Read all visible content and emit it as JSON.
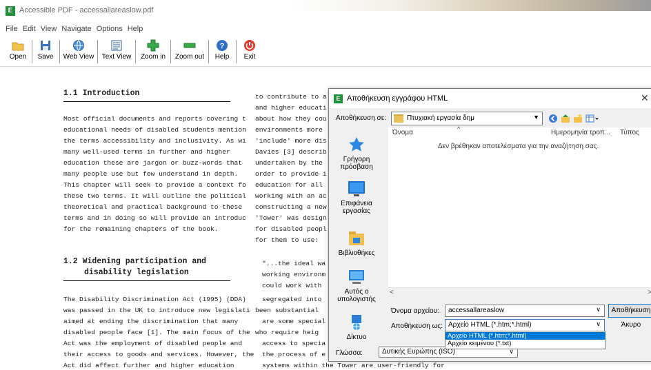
{
  "window": {
    "title": "Accessible PDF - accessallareaslow.pdf"
  },
  "menu": [
    "File",
    "Edit",
    "View",
    "Navigate",
    "Options",
    "Help"
  ],
  "toolbar": [
    {
      "label": "Open",
      "icon": "folder-icon"
    },
    {
      "label": "Save",
      "icon": "floppy-icon"
    },
    {
      "label": "Web View",
      "icon": "globe-icon"
    },
    {
      "label": "Text View",
      "icon": "text-view-icon"
    },
    {
      "label": "Zoom in",
      "icon": "zoom-in-icon"
    },
    {
      "label": "Zoom out",
      "icon": "zoom-out-icon"
    },
    {
      "label": "Help",
      "icon": "help-icon"
    },
    {
      "label": "Exit",
      "icon": "power-icon"
    }
  ],
  "document": {
    "left_lines": [
      "1.1 Introduction",
      "",
      "Most official documents and reports covering t",
      "educational needs of disabled students mention",
      "the terms accessibility and inclusivity. As wi",
      "many well-used terms in further and higher",
      "education these are jargon or buzz-words that",
      "many people use but few understand in depth.",
      "This chapter will seek to provide a context fo",
      "these two terms. It will outline the political",
      "theoretical and practical background to these",
      "terms and in doing so will provide an introduc",
      "for the remaining chapters of the book.",
      "1.2 Widening participation and",
      "disability legislation",
      "The Disability Discrimination Act (1995) (DDA)",
      "was passed in the UK to introduce new legislati",
      "aimed at ending the discrimination that many",
      "disabled people face [1]. The main focus of the",
      "Act was the employment of disabled people and",
      "their access to goods and services. However, the",
      "Act did affect further and higher education"
    ],
    "right_lines": [
      "to contribute to a",
      "and higher educati",
      "about how they cou",
      "environments more",
      "'include' more dis",
      "Davies [3] describ",
      "undertaken by the",
      "order to provide i",
      "education for all",
      "working with an ac",
      "constructing a new",
      "'Tower' was design",
      "for disabled peopl",
      "for them to use:",
      "\"...the ideal wa",
      "working environm",
      "could work with",
      "segregated into",
      "been substantial",
      "are some special",
      "who require heig",
      "access to specia",
      "the process of e",
      "systems within the Tower are user-friendly for"
    ]
  },
  "dialog": {
    "title": "Αποθήκευση εγγράφου HTML",
    "close": "✕",
    "save_in_label": "Αποθήκευση σε:",
    "save_in_value": "Πτυχιακή εργασία δημ",
    "places": [
      {
        "label": "Γρήγορη πρόσβαση",
        "icon": "star-icon"
      },
      {
        "label": "Επιφάνεια εργασίας",
        "icon": "desktop-icon"
      },
      {
        "label": "Βιβλιοθήκες",
        "icon": "library-icon"
      },
      {
        "label": "Αυτός ο υπολογιστής",
        "icon": "computer-icon"
      },
      {
        "label": "Δίκτυο",
        "icon": "network-icon"
      }
    ],
    "columns": {
      "name": "Όνομα",
      "date": "Ημερομηνία τροπ...",
      "type": "Τύπος"
    },
    "empty_message": "Δεν βρέθηκαν αποτελέσματα για την αναζήτηση σας.",
    "filename_label": "Όνομα αρχείου:",
    "filename_value": "accessallareaslow",
    "save_as_label": "Αποθήκευση ως:",
    "save_as_value": "Αρχείο HTML (*.htm;*.html)",
    "save_as_options": [
      "Αρχείο HTML (*.htm;*.html)",
      "Αρχείο κειμένου (*.txt)"
    ],
    "language_label": "Γλώσσα:",
    "language_value": "Δυτικής Ευρώπης (ISO)",
    "save_button": "Αποθήκευση",
    "cancel_button": "Άκυρο"
  },
  "colors": {
    "accent": "#0078d7",
    "app_icon": "#1f8f3a"
  }
}
